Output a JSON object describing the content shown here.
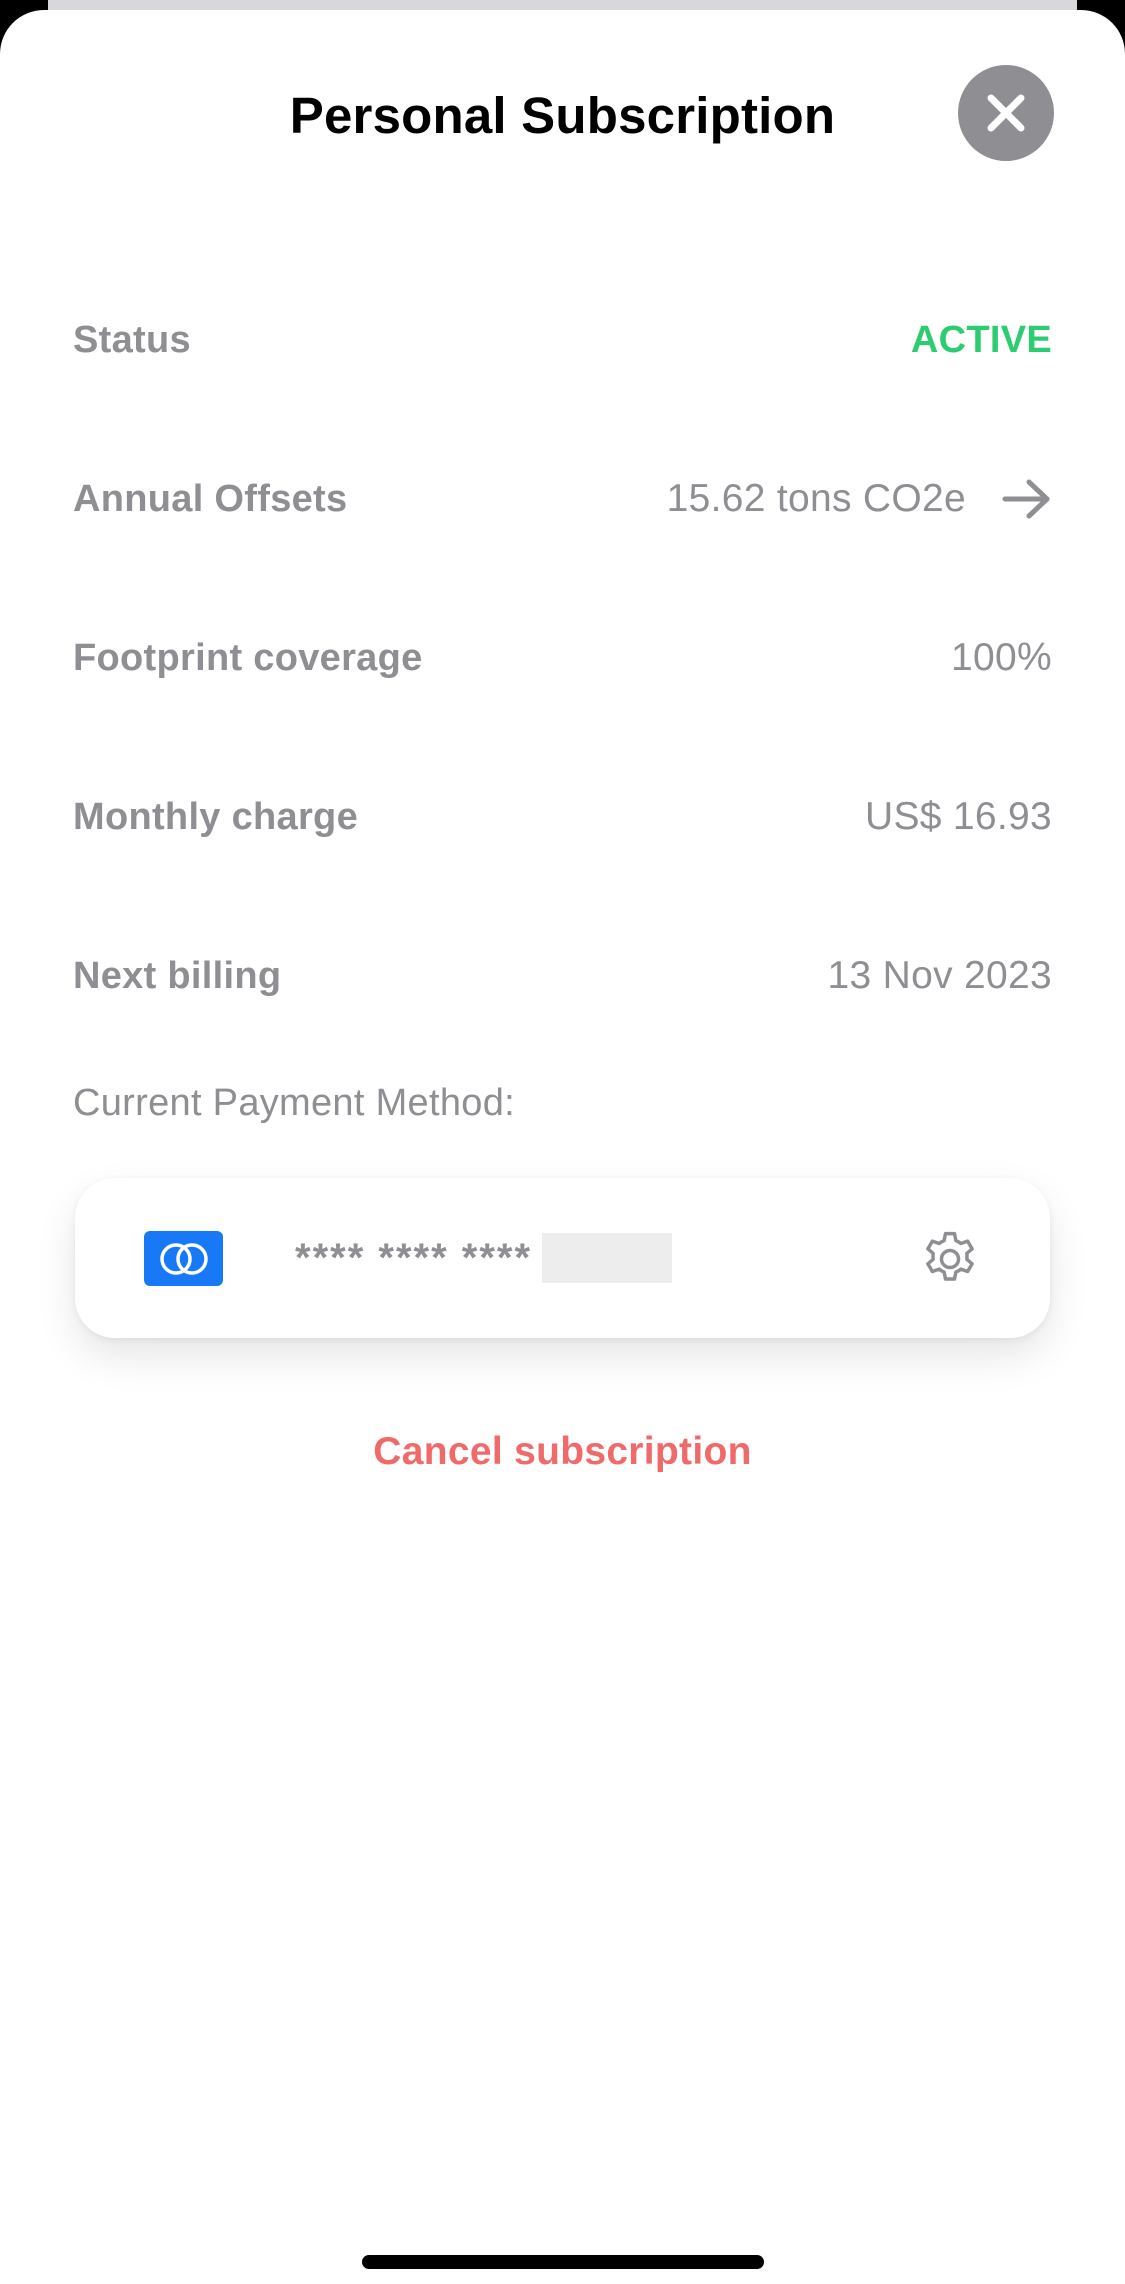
{
  "sheet": {
    "title": "Personal Subscription"
  },
  "details": {
    "status": {
      "label": "Status",
      "value": "ACTIVE"
    },
    "annual_offsets": {
      "label": "Annual Offsets",
      "value": "15.62 tons CO2e"
    },
    "footprint_coverage": {
      "label": "Footprint coverage",
      "value": "100%"
    },
    "monthly_charge": {
      "label": "Monthly charge",
      "value": "US$ 16.93"
    },
    "next_billing": {
      "label": "Next billing",
      "value": "13 Nov 2023"
    }
  },
  "payment": {
    "heading": "Current Payment Method:",
    "masked_number": "**** **** ****"
  },
  "actions": {
    "cancel_label": "Cancel subscription"
  },
  "icons": {
    "close": "close-icon",
    "arrow": "arrow-right-icon",
    "card_brand": "card-brand-icon",
    "settings": "gear-icon"
  },
  "colors": {
    "status_active": "#2ecc71",
    "cancel": "#f06a6a",
    "muted_text": "#8e8e93",
    "card_brand_bg": "#1779f5"
  }
}
